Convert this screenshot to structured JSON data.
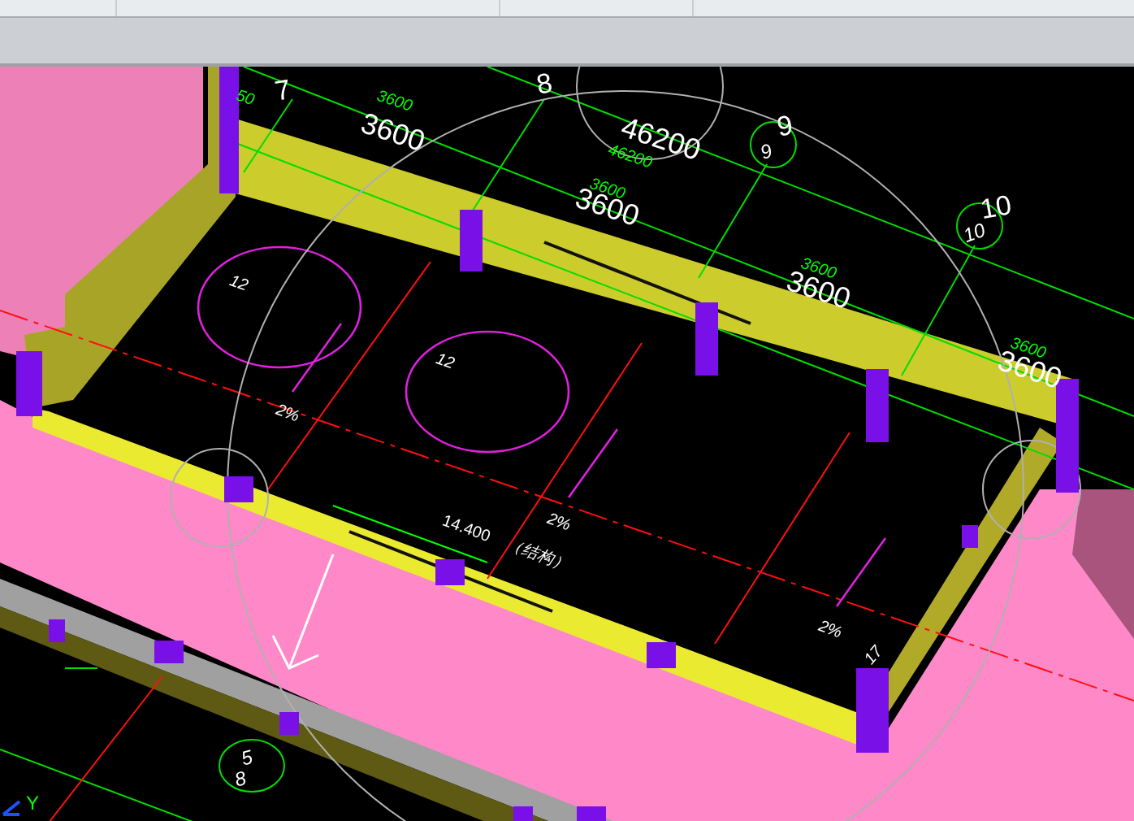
{
  "viewport": {
    "labels": [
      {
        "kind": "axis",
        "text": "7"
      },
      {
        "kind": "dim_small",
        "text": "50"
      },
      {
        "kind": "axis",
        "text": "8"
      },
      {
        "kind": "dim_small",
        "text": "3600"
      },
      {
        "kind": "dim_large",
        "text": "3600"
      },
      {
        "kind": "dim_large",
        "text": "46200"
      },
      {
        "kind": "dim_small",
        "text": "46200"
      },
      {
        "kind": "axis",
        "text": "9"
      },
      {
        "kind": "axis_small",
        "text": "9"
      },
      {
        "kind": "dim_small",
        "text": "3600"
      },
      {
        "kind": "dim_large",
        "text": "3600"
      },
      {
        "kind": "axis",
        "text": "10"
      },
      {
        "kind": "axis_small",
        "text": "10"
      },
      {
        "kind": "dim_small",
        "text": "3600"
      },
      {
        "kind": "dim_large",
        "text": "3600"
      },
      {
        "kind": "dim_small",
        "text": "3600"
      },
      {
        "kind": "dim_large",
        "text": "3600"
      },
      {
        "kind": "note",
        "text": "12"
      },
      {
        "kind": "note",
        "text": "12"
      },
      {
        "kind": "slope",
        "text": "2%"
      },
      {
        "kind": "slope",
        "text": "2%"
      },
      {
        "kind": "slope",
        "text": "2%"
      },
      {
        "kind": "elevation",
        "text": "14.400"
      },
      {
        "kind": "note",
        "text": "（结构）"
      },
      {
        "kind": "note",
        "text": "17"
      },
      {
        "kind": "axis_small",
        "text": "5"
      },
      {
        "kind": "axis_small",
        "text": "8"
      },
      {
        "kind": "axis_letter",
        "text": "Y"
      }
    ]
  }
}
